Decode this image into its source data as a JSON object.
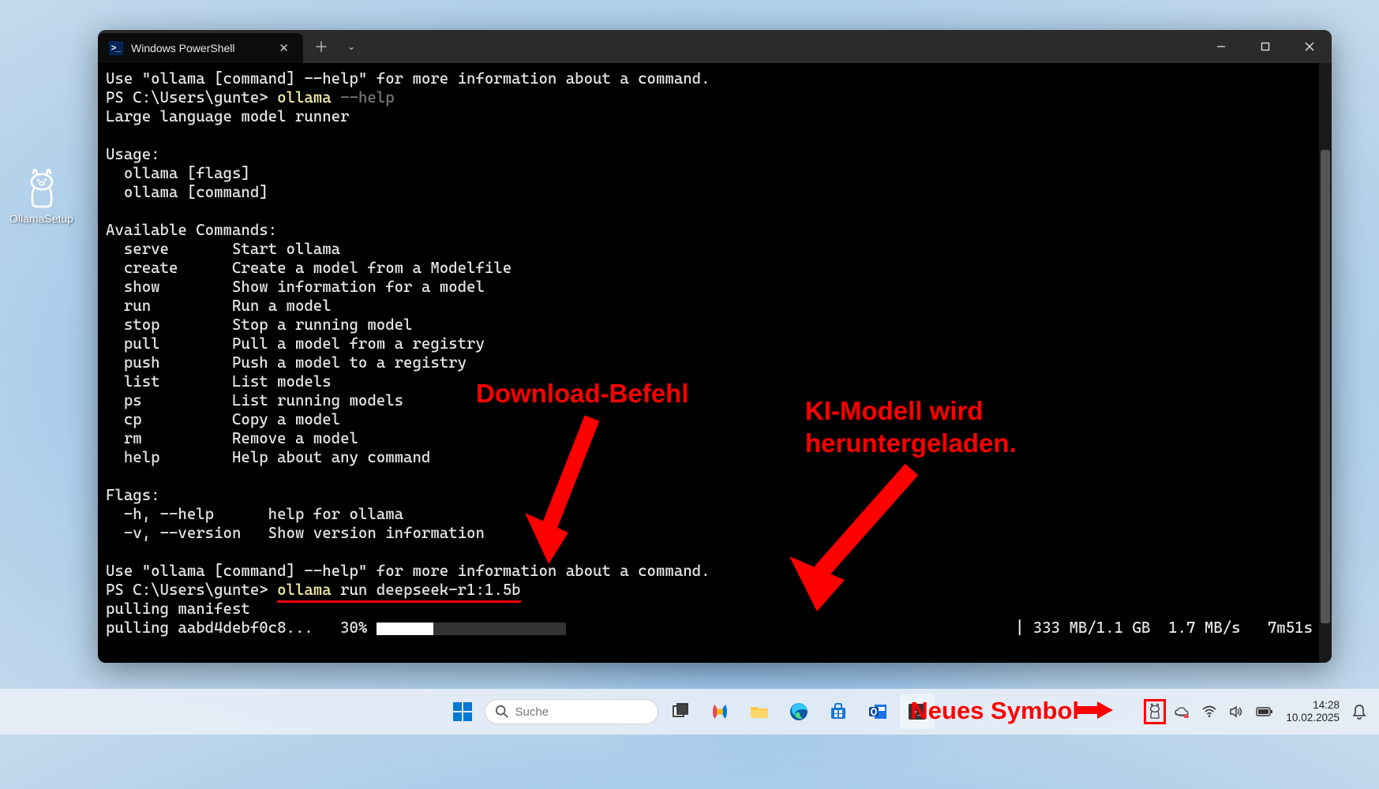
{
  "desktop": {
    "icon_label": "OllamaSetup"
  },
  "window": {
    "tab_title": "Windows PowerShell"
  },
  "terminal": {
    "line1": "Use \"ollama [command] --help\" for more information about a command.",
    "prompt1": "PS C:\\Users\\gunte>",
    "cmd1": "ollama",
    "cmd1_arg": "--help",
    "line_desc": "Large language model runner",
    "usage_hdr": "Usage:",
    "usage1": "  ollama [flags]",
    "usage2": "  ollama [command]",
    "avail_hdr": "Available Commands:",
    "commands": [
      [
        "serve",
        "Start ollama"
      ],
      [
        "create",
        "Create a model from a Modelfile"
      ],
      [
        "show",
        "Show information for a model"
      ],
      [
        "run",
        "Run a model"
      ],
      [
        "stop",
        "Stop a running model"
      ],
      [
        "pull",
        "Pull a model from a registry"
      ],
      [
        "push",
        "Push a model to a registry"
      ],
      [
        "list",
        "List models"
      ],
      [
        "ps",
        "List running models"
      ],
      [
        "cp",
        "Copy a model"
      ],
      [
        "rm",
        "Remove a model"
      ],
      [
        "help",
        "Help about any command"
      ]
    ],
    "flags_hdr": "Flags:",
    "flag1": "  -h, --help      help for ollama",
    "flag2": "  -v, --version   Show version information",
    "line_foot": "Use \"ollama [command] --help\" for more information about a command.",
    "prompt2": "PS C:\\Users\\gunte>",
    "cmd2_ollama": "ollama",
    "cmd2_rest": " run deepseek-r1:1.5b",
    "pulling1": "pulling manifest",
    "pulling2_pre": "pulling aabd4debf0c8...   30% ",
    "stats": "| 333 MB/1.1 GB  1.7 MB/s   7m51s",
    "progress_pct": 30
  },
  "annotations": {
    "download": "Download-Befehl",
    "kimodel": "KI-Modell wird\nheruntergeladen.",
    "neues": "Neues Symbol"
  },
  "taskbar": {
    "search_placeholder": "Suche",
    "time": "14:28",
    "date": "10.02.2025"
  }
}
